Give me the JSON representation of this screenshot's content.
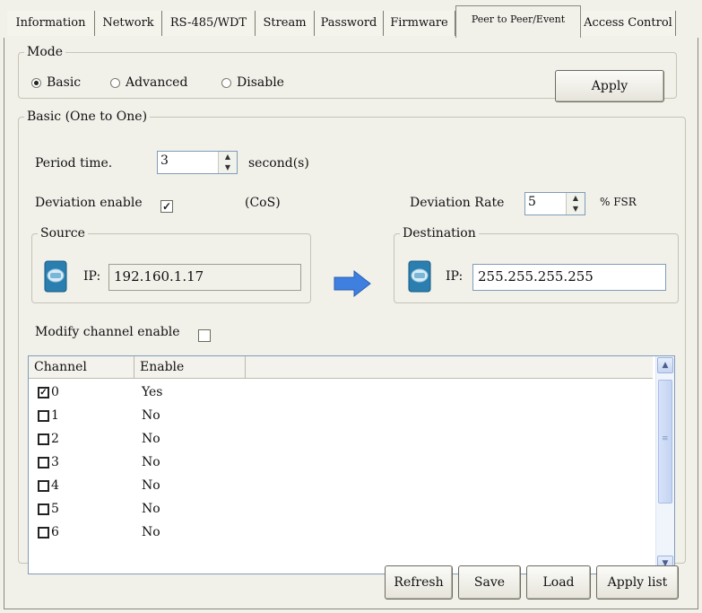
{
  "tabs": [
    "Information",
    "Network",
    "RS-485/WDT",
    "Stream",
    "Password",
    "Firmware",
    "Peer to Peer/Event",
    "Access Control"
  ],
  "active_tab": "Peer to Peer/Event",
  "mode": {
    "legend": "Mode",
    "options": [
      "Basic",
      "Advanced",
      "Disable"
    ],
    "selected": "Basic",
    "apply_label": "Apply"
  },
  "basic": {
    "legend": "Basic (One to One)",
    "period_label": "Period time.",
    "period_value": "3",
    "period_unit": "second(s)",
    "deviation_label": "Deviation enable",
    "deviation_checked": true,
    "cos_label": "(CoS)",
    "rate_label": "Deviation Rate",
    "rate_value": "5",
    "rate_unit": "% FSR"
  },
  "source": {
    "legend": "Source",
    "ip_label": "IP:",
    "ip": "192.160.1.17"
  },
  "destination": {
    "legend": "Destination",
    "ip_label": "IP:",
    "ip": "255.255.255.255"
  },
  "modify_label": "Modify channel enable",
  "modify_checked": false,
  "channel_list": {
    "columns": [
      "Channel",
      "Enable"
    ],
    "rows": [
      {
        "channel": "0",
        "enable": "Yes",
        "checked": true
      },
      {
        "channel": "1",
        "enable": "No",
        "checked": false
      },
      {
        "channel": "2",
        "enable": "No",
        "checked": false
      },
      {
        "channel": "3",
        "enable": "No",
        "checked": false
      },
      {
        "channel": "4",
        "enable": "No",
        "checked": false
      },
      {
        "channel": "5",
        "enable": "No",
        "checked": false
      },
      {
        "channel": "6",
        "enable": "No",
        "checked": false
      }
    ]
  },
  "buttons": {
    "refresh": "Refresh",
    "save": "Save",
    "load": "Load",
    "apply_list": "Apply list"
  },
  "colors": {
    "window_bg": "#f1f0e9",
    "arrow": "#3f7fe0",
    "field_border": "#7f9db9"
  },
  "icons": {
    "arrow": "right-arrow-icon",
    "device": "device-icon"
  }
}
